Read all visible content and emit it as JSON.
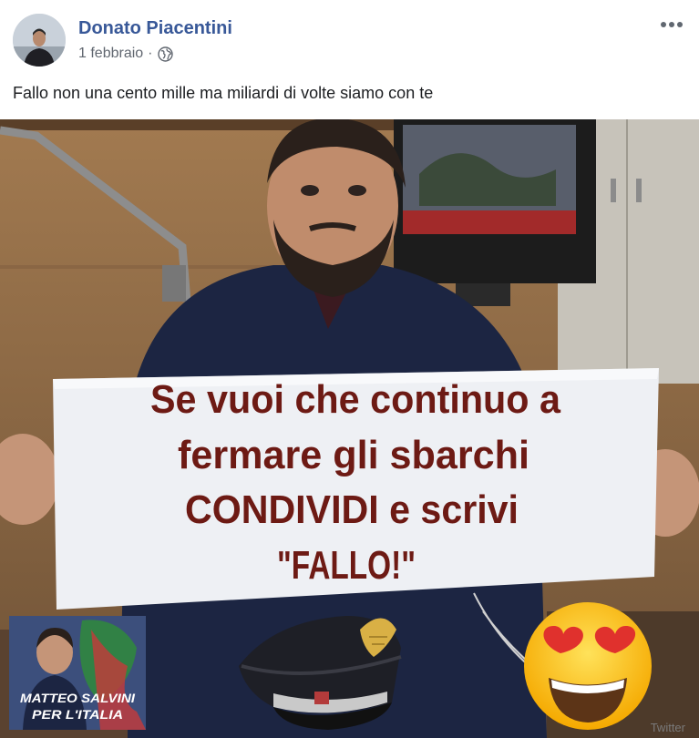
{
  "post": {
    "author": "Donato Piacentini",
    "date": "1 febbraio",
    "separator": "·",
    "privacy_icon": "globe-icon",
    "more_icon": "more-options-icon",
    "text": "Fallo non una cento mille ma miliardi di volte siamo con te"
  },
  "image": {
    "sign_lines": [
      "Se vuoi che continuo a",
      "fermare gli sbarchi",
      "CONDIVIDI e scrivi",
      "\"FALLO!\""
    ],
    "badge_lines": [
      "MATTEO SALVINI",
      "PER L'ITALIA"
    ],
    "watermark": "Twitter",
    "emoji": "heart-eyes-emoji",
    "cap_icon": "carabinieri-cap-icon"
  },
  "colors": {
    "author_name": "#385898",
    "meta_text": "#616770",
    "sign_text": "#6d1a14"
  }
}
